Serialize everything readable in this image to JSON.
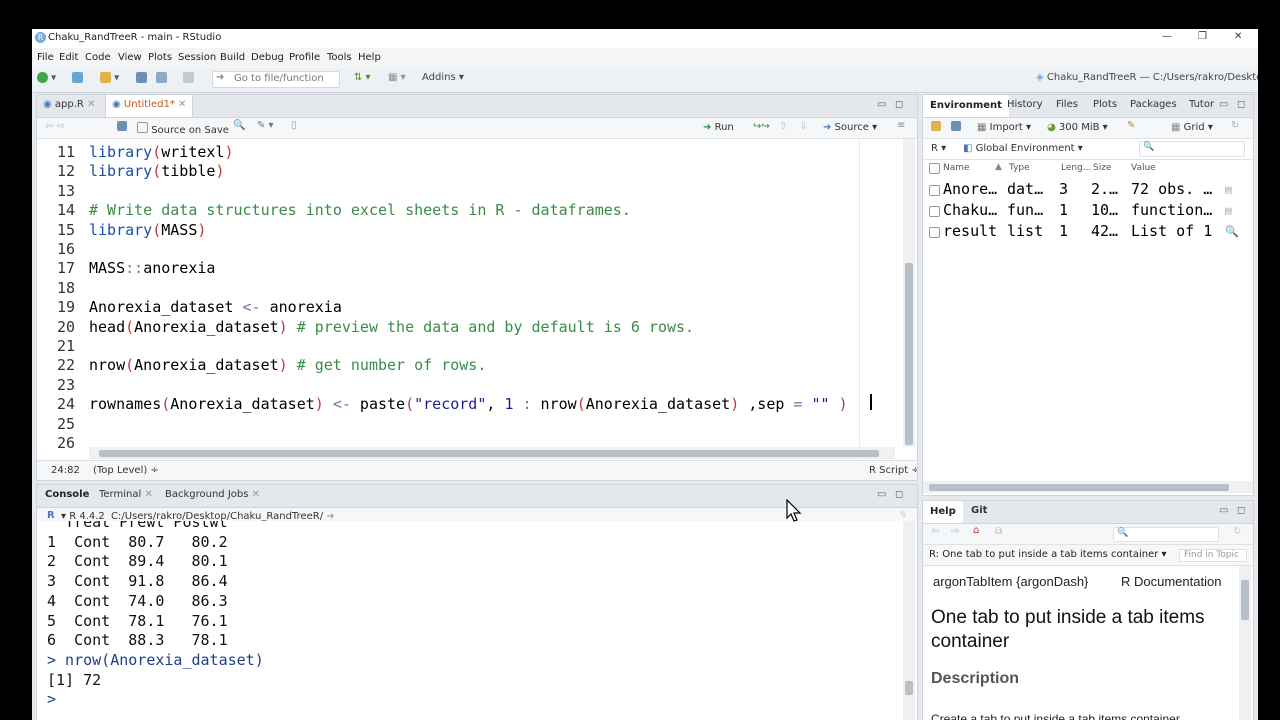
{
  "window": {
    "title": "Chaku_RandTreeR - main - RStudio",
    "controls": [
      "—",
      "❐",
      "✕"
    ]
  },
  "menu": [
    "File",
    "Edit",
    "Code",
    "View",
    "Plots",
    "Session",
    "Build",
    "Debug",
    "Profile",
    "Tools",
    "Help"
  ],
  "toolbar": {
    "goto_placeholder": "Go to file/function",
    "addins": "Addins",
    "project": "Chaku_RandTreeR — C:/Users/rakro/Desktop"
  },
  "editor": {
    "tabs": [
      {
        "label": "app.R"
      },
      {
        "label": "Untitled1*"
      }
    ],
    "source_on_save": "Source on Save",
    "run": "Run",
    "source": "Source",
    "status_pos": "24:82",
    "status_level": "(Top Level) ÷",
    "status_type": "R Script ÷",
    "lines": [
      {
        "n": "11",
        "html": "<span class='kw'>library</span><span class='par'>(</span>writexl<span class='par'>)</span>"
      },
      {
        "n": "12",
        "html": "<span class='kw'>library</span><span class='par'>(</span>tibble<span class='par'>)</span>"
      },
      {
        "n": "13",
        "html": ""
      },
      {
        "n": "14",
        "html": "<span class='cm'># Write data structures into excel sheets in R - dataframes.</span>"
      },
      {
        "n": "15",
        "html": "<span class='kw'>library</span><span class='par'>(</span>MASS<span class='par'>)</span>"
      },
      {
        "n": "16",
        "html": ""
      },
      {
        "n": "17",
        "html": "MASS<span class='op'>::</span>anorexia"
      },
      {
        "n": "18",
        "html": ""
      },
      {
        "n": "19",
        "html": "Anorexia_dataset <span class='op'>&lt;-</span> anorexia"
      },
      {
        "n": "20",
        "html": "head<span class='par'>(</span>Anorexia_dataset<span class='par'>)</span> <span class='cm'># preview the data and by default is 6 rows.</span>"
      },
      {
        "n": "21",
        "html": ""
      },
      {
        "n": "22",
        "html": "nrow<span class='par'>(</span>Anorexia_dataset<span class='par'>)</span> <span class='cm'># get number of rows.</span>"
      },
      {
        "n": "23",
        "html": ""
      },
      {
        "n": "24",
        "html": "rownames<span class='par'>(</span>Anorexia_dataset<span class='par'>)</span> <span class='op'>&lt;-</span> paste<span class='par'>(</span><span class='str'>\"record\"</span>, <span class='num'>1</span> <span class='op'>:</span> nrow<span class='par'>(</span>Anorexia_dataset<span class='par'>)</span> ,sep <span class='op'>=</span> <span class='str'>\"\"</span> <span class='par'>)</span>"
      },
      {
        "n": "25",
        "html": ""
      },
      {
        "n": "26",
        "html": ""
      }
    ]
  },
  "console": {
    "tabs": [
      "Console",
      "Terminal",
      "Background Jobs"
    ],
    "r_version": "R 4.4.2",
    "path": "C:/Users/rakro/Desktop/Chaku_RandTreeR/",
    "lines": [
      "  Treat Prewt Postwt",
      "1  Cont  80.7   80.2",
      "2  Cont  89.4   80.1",
      "3  Cont  91.8   86.4",
      "4  Cont  74.0   86.3",
      "5  Cont  78.1   76.1",
      "6  Cont  88.3   78.1",
      "> nrow(Anorexia_dataset)",
      "[1] 72",
      "> "
    ]
  },
  "environment": {
    "tabs": [
      "Environment",
      "History",
      "Files",
      "Plots",
      "Packages",
      "Tutor"
    ],
    "import": "Import",
    "memory": "300 MiB",
    "grid": "Grid",
    "lang": "R",
    "scope": "Global Environment",
    "columns": [
      "Name",
      "Type",
      "Leng...",
      "Size",
      "Value"
    ],
    "rows": [
      {
        "name": "Anore…",
        "type": "dat…",
        "len": "3",
        "size": "2.…",
        "value": "72 obs. …"
      },
      {
        "name": "Chaku…",
        "type": "fun…",
        "len": "1",
        "size": "10…",
        "value": "function…"
      },
      {
        "name": "result",
        "type": "list",
        "len": "1",
        "size": "42…",
        "value": "List of 1"
      }
    ]
  },
  "help": {
    "tabs": [
      "Help",
      "Git"
    ],
    "topic": "R: One tab to put inside a tab items container",
    "find": "Find in Topic",
    "pkg": "argonTabItem {argonDash}",
    "doc": "R Documentation",
    "heading": "One tab to put inside a tab items container",
    "section": "Description",
    "cut": "Create a tab to put inside a tab items container"
  }
}
